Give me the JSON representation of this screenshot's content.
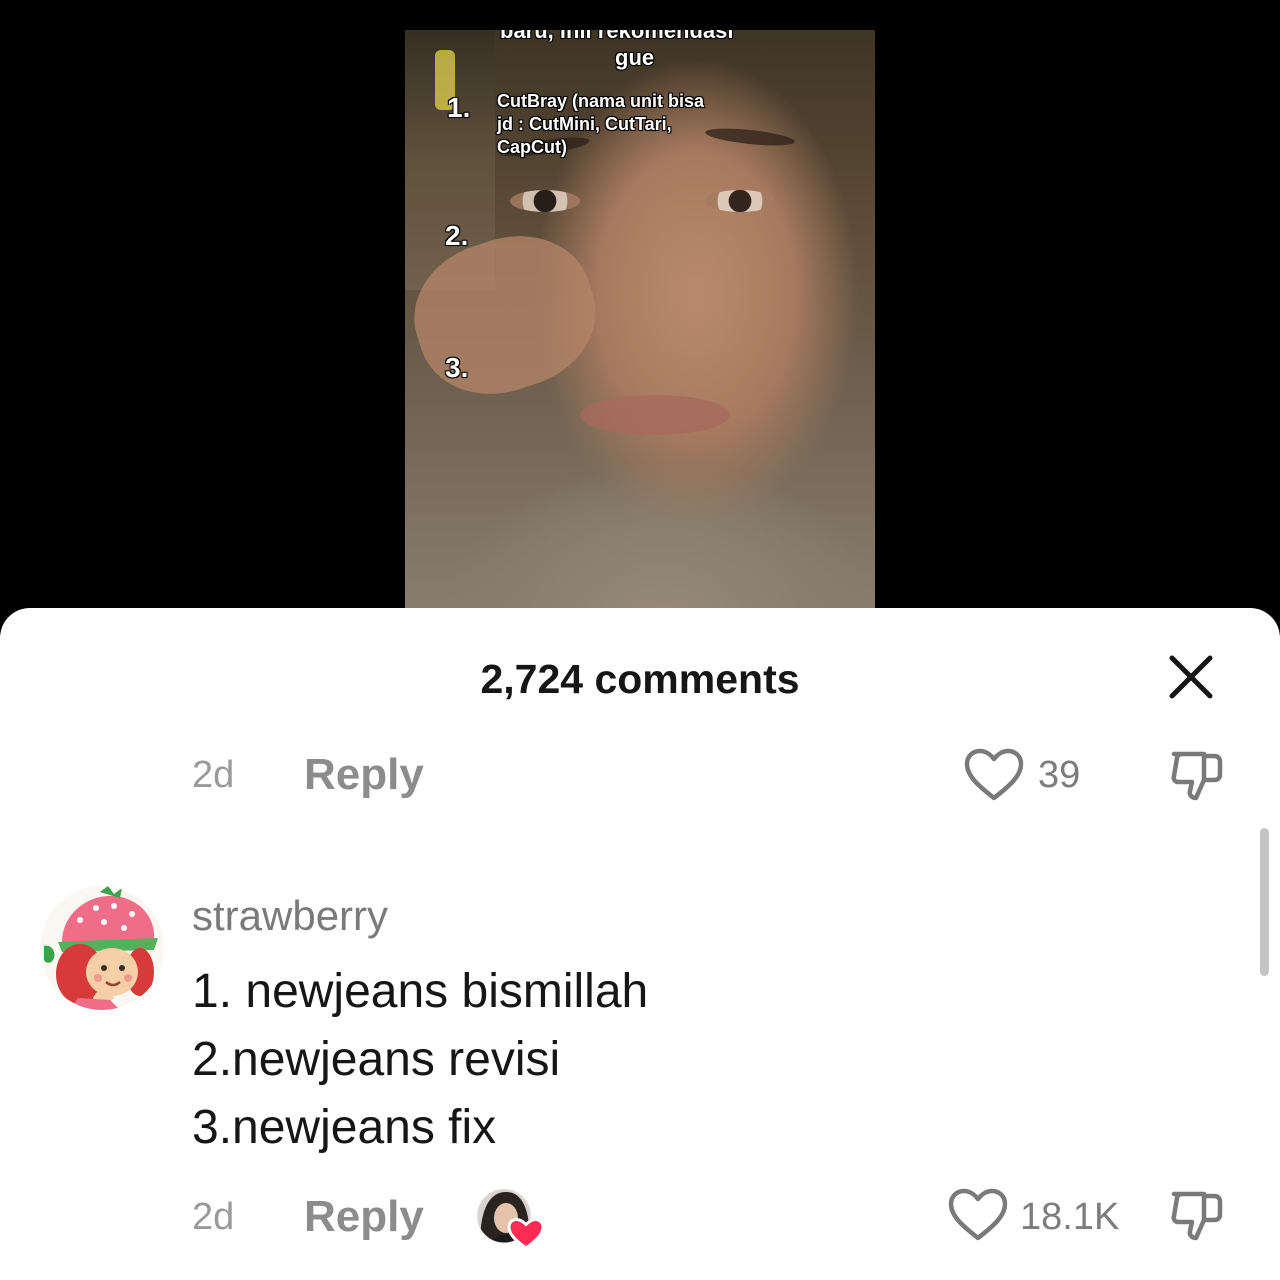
{
  "video": {
    "overlay_top": "baru, inii rekomendasi",
    "overlay_gue": "gue",
    "list": [
      {
        "num": "1.",
        "text_lines": [
          "CutBray (nama unit bisa",
          "jd : CutMini, CutTari,",
          "CapCut)"
        ]
      },
      {
        "num": "2."
      },
      {
        "num": "3."
      }
    ]
  },
  "sheet": {
    "title": "2,724 comments",
    "close_icon": "close-icon"
  },
  "comments": [
    {
      "time": "2d",
      "reply_label": "Reply",
      "likes": "39"
    },
    {
      "username": "strawberry",
      "lines": [
        "1. newjeans bismillah",
        "2.newjeans revisi",
        "3.newjeans fix"
      ],
      "time": "2d",
      "reply_label": "Reply",
      "likes": "18.1K",
      "creator_liked": true
    }
  ],
  "colors": {
    "heart_fill": "#fe2c55",
    "icon_stroke": "#7a7a7a"
  }
}
